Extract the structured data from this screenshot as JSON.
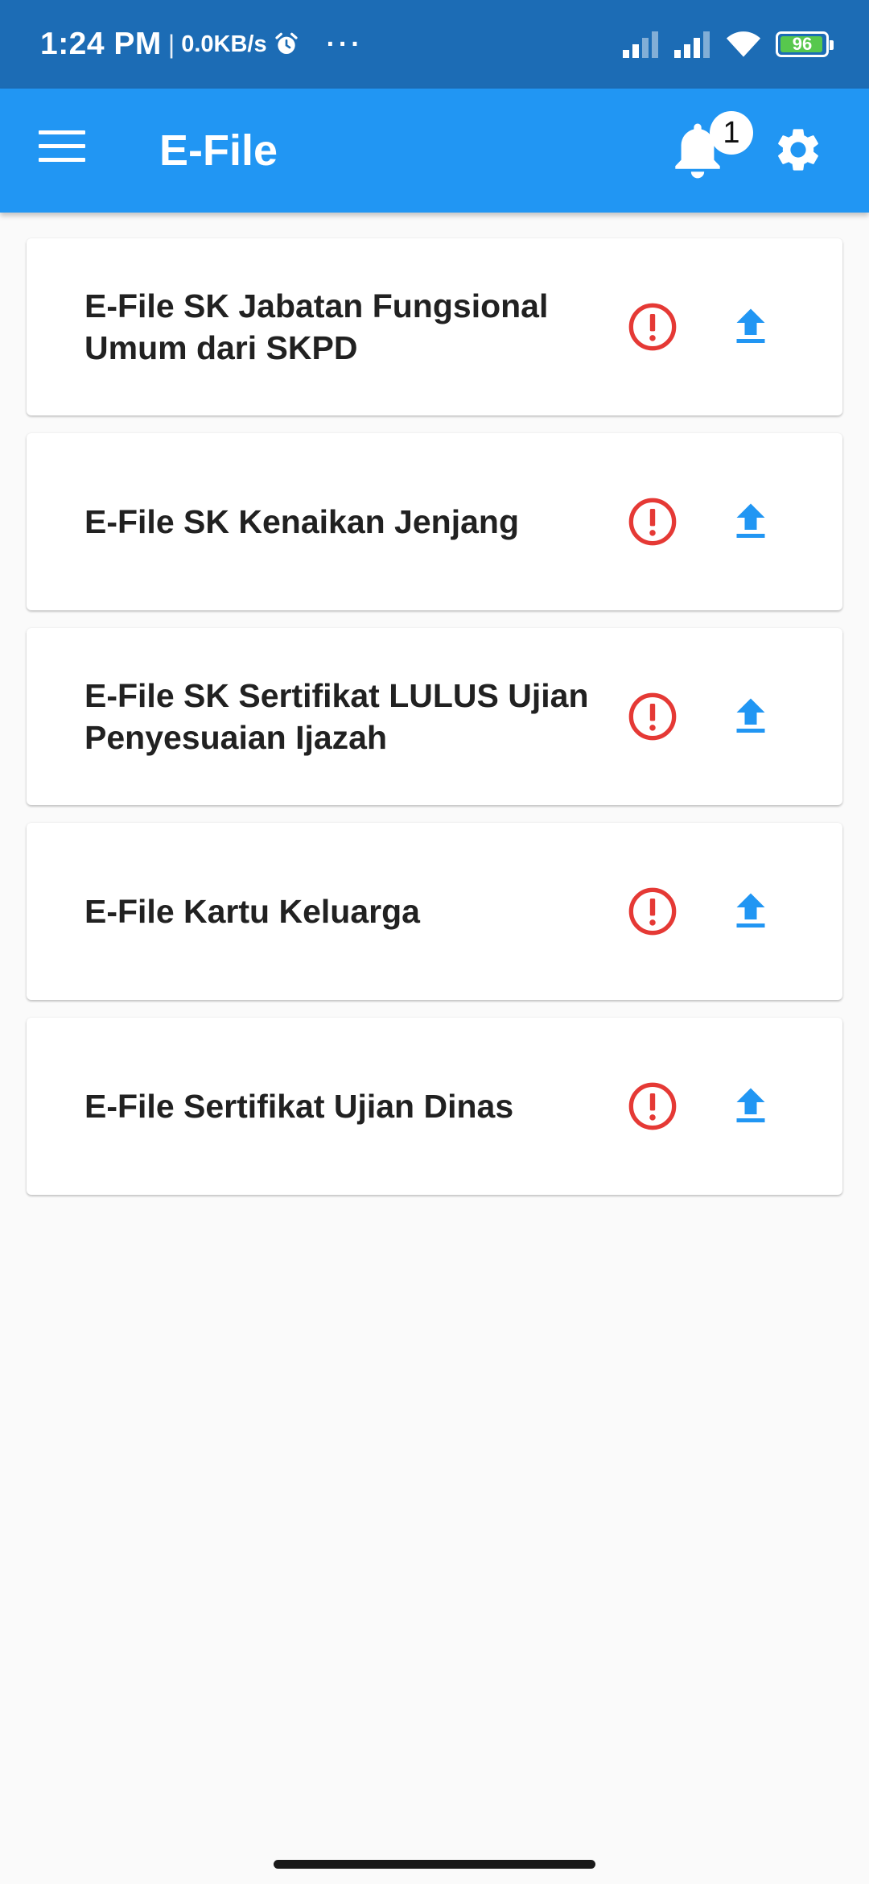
{
  "status_bar": {
    "time": "1:24 PM",
    "separator": "|",
    "speed": "0.0KB/s",
    "dots": "···",
    "battery": "96",
    "battery_fraction": 0.96,
    "icons": [
      "alarm-icon",
      "signal-icon",
      "signal-icon",
      "wifi-icon",
      "battery-icon"
    ]
  },
  "app_bar": {
    "title": "E-File",
    "notification_count": "1",
    "color": "#2196f3",
    "icons": [
      "menu-icon",
      "bell-icon",
      "gear-icon"
    ]
  },
  "files": [
    {
      "title": "E-File SK Jabatan Fungsional Umum dari SKPD"
    },
    {
      "title": "E-File SK Kenaikan Jenjang"
    },
    {
      "title": "E-File SK Sertifikat LULUS Ujian Penyesuaian Ijazah"
    },
    {
      "title": "E-File Kartu Keluarga"
    },
    {
      "title": "E-File Sertifikat Ujian Dinas"
    }
  ],
  "row_icons": {
    "status": "alert-circle-icon",
    "action": "upload-icon"
  },
  "colors": {
    "status_bar": "#1c6cb5",
    "warning": "#e53935",
    "upload": "#2196f3",
    "battery": "#57c84d"
  }
}
